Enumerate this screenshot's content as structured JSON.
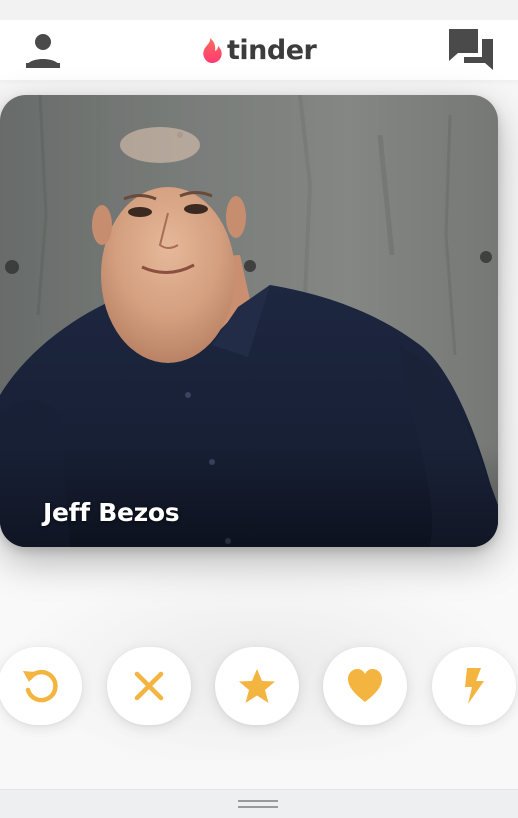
{
  "app": {
    "logo_text": "tinder",
    "brand_color": "#fd5068",
    "action_color": "#f3b440"
  },
  "header": {
    "profile_icon": "person-icon",
    "messages_icon": "chat-bubbles-icon"
  },
  "card": {
    "name": "Jeff Bezos"
  },
  "actions": [
    {
      "name": "rewind",
      "icon": "undo-icon"
    },
    {
      "name": "nope",
      "icon": "close-icon"
    },
    {
      "name": "super-like",
      "icon": "star-icon"
    },
    {
      "name": "like",
      "icon": "heart-icon"
    },
    {
      "name": "boost",
      "icon": "lightning-icon"
    }
  ]
}
